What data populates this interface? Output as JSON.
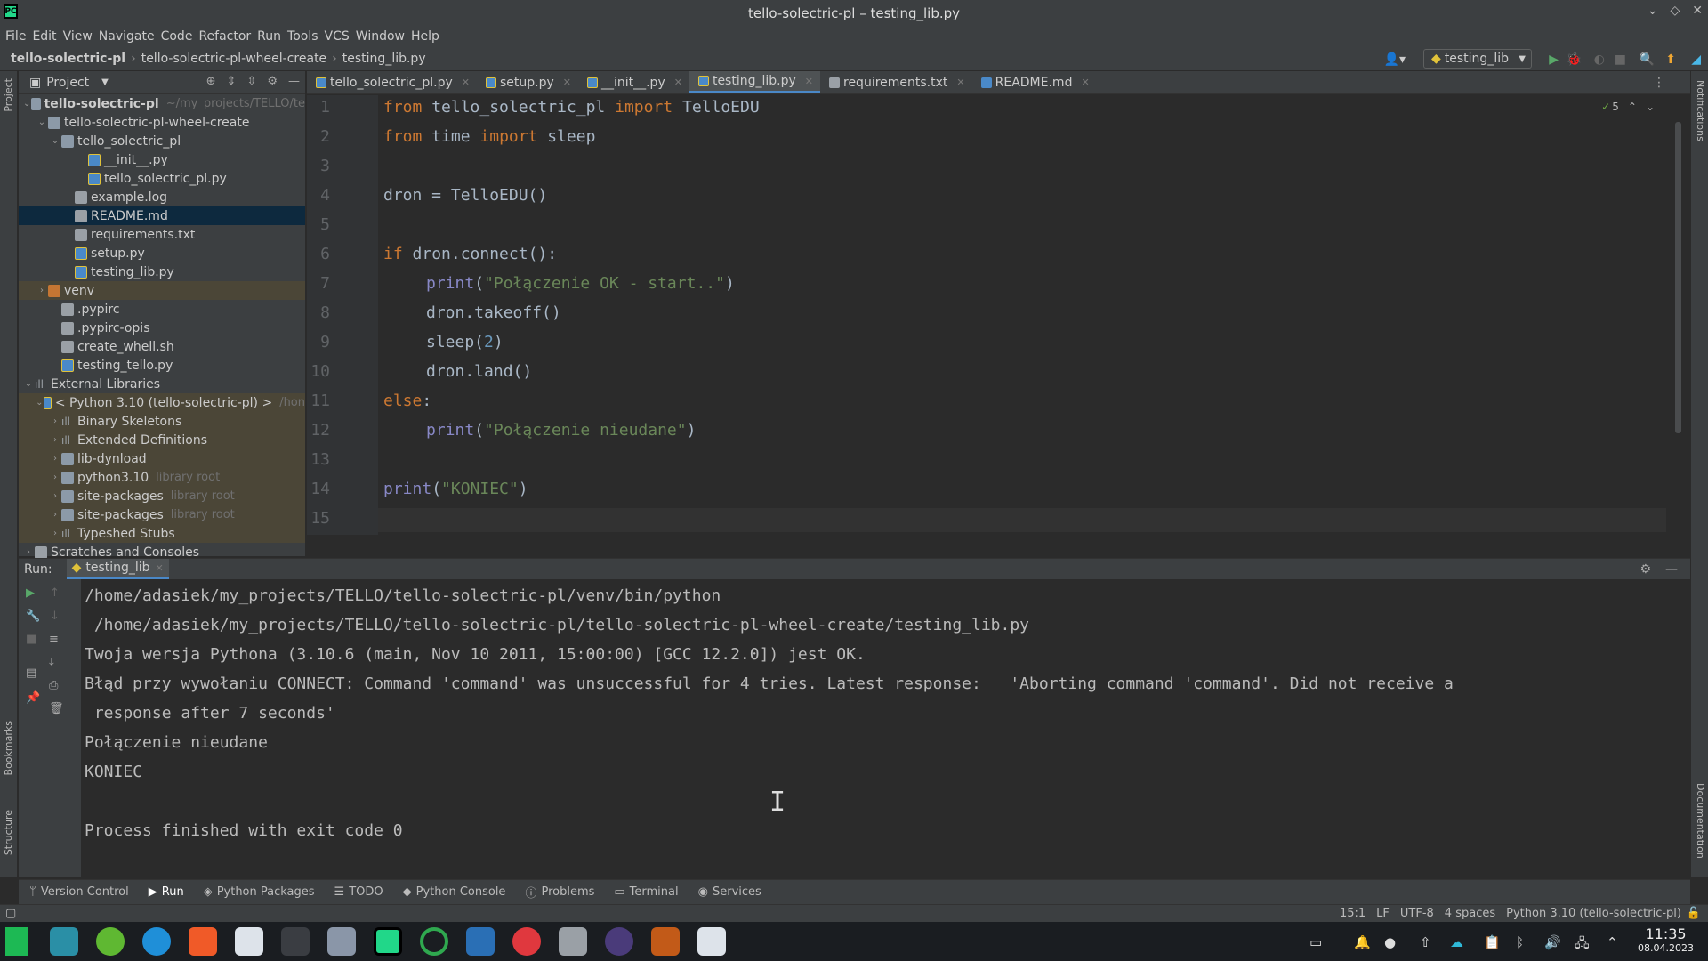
{
  "window": {
    "title": "tello-solectric-pl – testing_lib.py",
    "logo": "PC"
  },
  "menu": [
    "File",
    "Edit",
    "View",
    "Navigate",
    "Code",
    "Refactor",
    "Run",
    "Tools",
    "VCS",
    "Window",
    "Help"
  ],
  "breadcrumb": [
    "tello-solectric-pl",
    "tello-solectric-pl-wheel-create",
    "testing_lib.py"
  ],
  "run_config": "testing_lib",
  "project_panel": {
    "title": "Project",
    "root": {
      "name": "tello-solectric-pl",
      "hint": "~/my_projects/TELLO/te"
    },
    "tree": [
      {
        "label": "tello-solectric-pl-wheel-create",
        "level": 1,
        "type": "folder",
        "expanded": true
      },
      {
        "label": "tello_solectric_pl",
        "level": 2,
        "type": "folder",
        "expanded": true
      },
      {
        "label": "__init__.py",
        "level": 3,
        "type": "py"
      },
      {
        "label": "tello_solectric_pl.py",
        "level": 3,
        "type": "py"
      },
      {
        "label": "example.log",
        "level": 2,
        "type": "file"
      },
      {
        "label": "README.md",
        "level": 2,
        "type": "md",
        "selected": true
      },
      {
        "label": "requirements.txt",
        "level": 2,
        "type": "file"
      },
      {
        "label": "setup.py",
        "level": 2,
        "type": "py"
      },
      {
        "label": "testing_lib.py",
        "level": 2,
        "type": "py"
      },
      {
        "label": "venv",
        "level": 1,
        "type": "folder-orange",
        "collapsed": true
      },
      {
        "label": ".pypirc",
        "level": 1,
        "type": "file"
      },
      {
        "label": ".pypirc-opis",
        "level": 1,
        "type": "file"
      },
      {
        "label": "create_whell.sh",
        "level": 1,
        "type": "file"
      },
      {
        "label": "testing_tello.py",
        "level": 1,
        "type": "py"
      }
    ],
    "external": {
      "label": "External Libraries",
      "python": "< Python 3.10 (tello-solectric-pl) >",
      "python_hint": "/hon",
      "items": [
        {
          "label": "Binary Skeletons",
          "hint": ""
        },
        {
          "label": "Extended Definitions",
          "hint": ""
        },
        {
          "label": "lib-dynload",
          "hint": ""
        },
        {
          "label": "python3.10",
          "hint": "library root"
        },
        {
          "label": "site-packages",
          "hint": "library root"
        },
        {
          "label": "site-packages",
          "hint": "library root"
        },
        {
          "label": "Typeshed Stubs",
          "hint": ""
        }
      ]
    },
    "scratches": "Scratches and Consoles"
  },
  "tabs": [
    {
      "label": "tello_solectric_pl.py",
      "icon": "py"
    },
    {
      "label": "setup.py",
      "icon": "py"
    },
    {
      "label": "__init__.py",
      "icon": "py"
    },
    {
      "label": "testing_lib.py",
      "icon": "py",
      "active": true
    },
    {
      "label": "requirements.txt",
      "icon": "txt"
    },
    {
      "label": "README.md",
      "icon": "md"
    }
  ],
  "editor": {
    "inspection_count": "5",
    "line_numbers": [
      "1",
      "2",
      "3",
      "4",
      "5",
      "6",
      "7",
      "8",
      "9",
      "10",
      "11",
      "12",
      "13",
      "14",
      "15"
    ]
  },
  "code": {
    "l1": {
      "kw1": "from",
      "mod": " tello_solectric_pl ",
      "kw2": "import",
      "name": " TelloEDU"
    },
    "l2": {
      "kw1": "from",
      "mod": " time ",
      "kw2": "import",
      "name": " sleep"
    },
    "l4": "dron = TelloEDU()",
    "l6": {
      "kw": "if",
      "rest": " dron.connect():"
    },
    "l7": {
      "fn": "print",
      "open": "(",
      "str": "\"Połączenie OK - start..\"",
      "close": ")"
    },
    "l8": "dron.takeoff()",
    "l9": {
      "pre": "sleep(",
      "num": "2",
      "post": ")"
    },
    "l10": "dron.land()",
    "l11": {
      "kw": "else",
      "rest": ":"
    },
    "l12": {
      "fn": "print",
      "open": "(",
      "str": "\"Połączenie nieudane\"",
      "close": ")"
    },
    "l14": {
      "fn": "print",
      "open": "(",
      "str": "\"KONIEC\"",
      "close": ")"
    }
  },
  "run_panel": {
    "label": "Run:",
    "tab": "testing_lib",
    "output": [
      "/home/adasiek/my_projects/TELLO/tello-solectric-pl/venv/bin/python",
      " /home/adasiek/my_projects/TELLO/tello-solectric-pl/tello-solectric-pl-wheel-create/testing_lib.py",
      "Twoja wersja Pythona (3.10.6 (main, Nov 10 2011, 15:00:00) [GCC 12.2.0]) jest OK.",
      "Błąd przy wywołaniu CONNECT: Command 'command' was unsuccessful for 4 tries. Latest response:   'Aborting command 'command'. Did not receive a",
      " response after 7 seconds'",
      "Połączenie nieudane",
      "KONIEC",
      "",
      "Process finished with exit code 0"
    ]
  },
  "tool_windows": [
    "Version Control",
    "Run",
    "Python Packages",
    "TODO",
    "Python Console",
    "Problems",
    "Terminal",
    "Services"
  ],
  "side_labels": {
    "project": "Project",
    "bookmarks": "Bookmarks",
    "structure": "Structure",
    "notifications": "Notifications",
    "documentation": "Documentation"
  },
  "status": {
    "position": "15:1",
    "line_sep": "LF",
    "encoding": "UTF-8",
    "indent": "4 spaces",
    "interpreter": "Python 3.10 (tello-solectric-pl)"
  },
  "taskbar": {
    "time": "11:35",
    "date": "08.04.2023"
  }
}
